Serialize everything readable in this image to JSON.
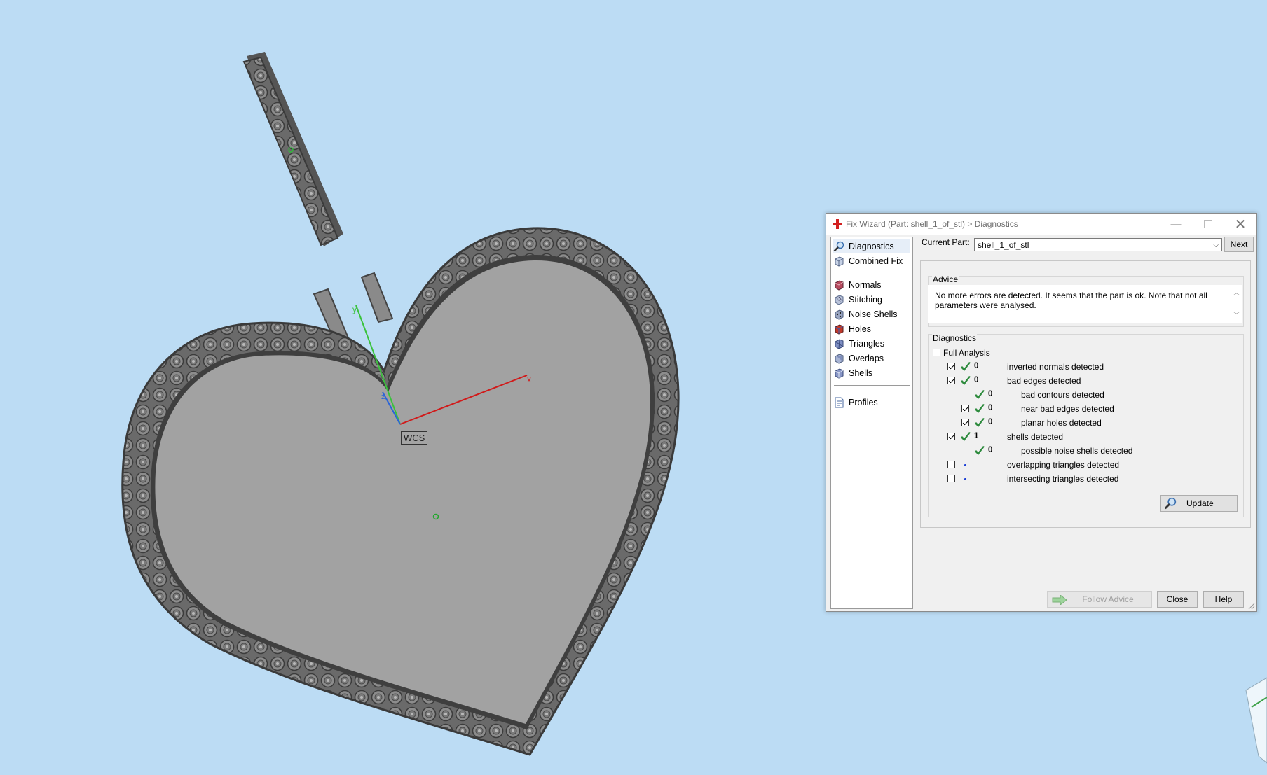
{
  "viewport": {
    "wcs_label": "WCS",
    "axis_label_x": "x",
    "axis_label_y": "y",
    "axis_label_z": "z",
    "background_color": "#bcdcf4",
    "model_color": "#a2a2a2"
  },
  "dialog": {
    "title": "Fix Wizard (Part: shell_1_of_stl) > Diagnostics",
    "nav": {
      "top_items": [
        {
          "label": "Diagnostics",
          "icon": "magnifier-icon",
          "selected": true
        },
        {
          "label": "Combined Fix",
          "icon": "cube-icon"
        }
      ],
      "fix_items": [
        {
          "label": "Normals",
          "icon": "normals-icon"
        },
        {
          "label": "Stitching",
          "icon": "stitching-icon"
        },
        {
          "label": "Noise Shells",
          "icon": "noise-shells-icon"
        },
        {
          "label": "Holes",
          "icon": "holes-icon"
        },
        {
          "label": "Triangles",
          "icon": "triangles-icon"
        },
        {
          "label": "Overlaps",
          "icon": "overlaps-icon"
        },
        {
          "label": "Shells",
          "icon": "shells-icon"
        }
      ],
      "bottom_items": [
        {
          "label": "Profiles",
          "icon": "document-icon"
        }
      ]
    },
    "current_part": {
      "label": "Current Part:",
      "value": "shell_1_of_stl",
      "next_label": "Next"
    },
    "advice": {
      "title": "Advice",
      "text": "No more errors are detected. It seems that the part is ok. Note that not all parameters were analysed."
    },
    "diagnostics": {
      "title": "Diagnostics",
      "full_analysis_label": "Full Analysis",
      "full_analysis_checked": false,
      "rows": [
        {
          "checkbox": true,
          "checked": true,
          "status": "ok",
          "count": "0",
          "label": "inverted normals detected",
          "indent": 0
        },
        {
          "checkbox": true,
          "checked": true,
          "status": "ok",
          "count": "0",
          "label": "bad edges detected",
          "indent": 0
        },
        {
          "checkbox": false,
          "checked": false,
          "status": "ok",
          "count": "0",
          "label": "bad contours detected",
          "indent": 1
        },
        {
          "checkbox": true,
          "checked": true,
          "status": "ok",
          "count": "0",
          "label": "near bad edges detected",
          "indent": 1
        },
        {
          "checkbox": true,
          "checked": true,
          "status": "ok",
          "count": "0",
          "label": "planar holes detected",
          "indent": 1
        },
        {
          "checkbox": true,
          "checked": true,
          "status": "ok",
          "count": "1",
          "label": "shells detected",
          "indent": 0
        },
        {
          "checkbox": false,
          "checked": false,
          "status": "ok",
          "count": "0",
          "label": "possible noise shells detected",
          "indent": 1
        },
        {
          "checkbox": true,
          "checked": false,
          "status": "none",
          "count": "",
          "label": "overlapping triangles detected",
          "indent": 0
        },
        {
          "checkbox": true,
          "checked": false,
          "status": "none",
          "count": "",
          "label": "intersecting triangles detected",
          "indent": 0
        }
      ],
      "update_label": "Update"
    },
    "footer": {
      "follow_advice_label": "Follow Advice",
      "close_label": "Close",
      "help_label": "Help"
    },
    "colors": {
      "ok_tick": "#2e8b3e",
      "red_cross": "#d21f1f"
    }
  }
}
